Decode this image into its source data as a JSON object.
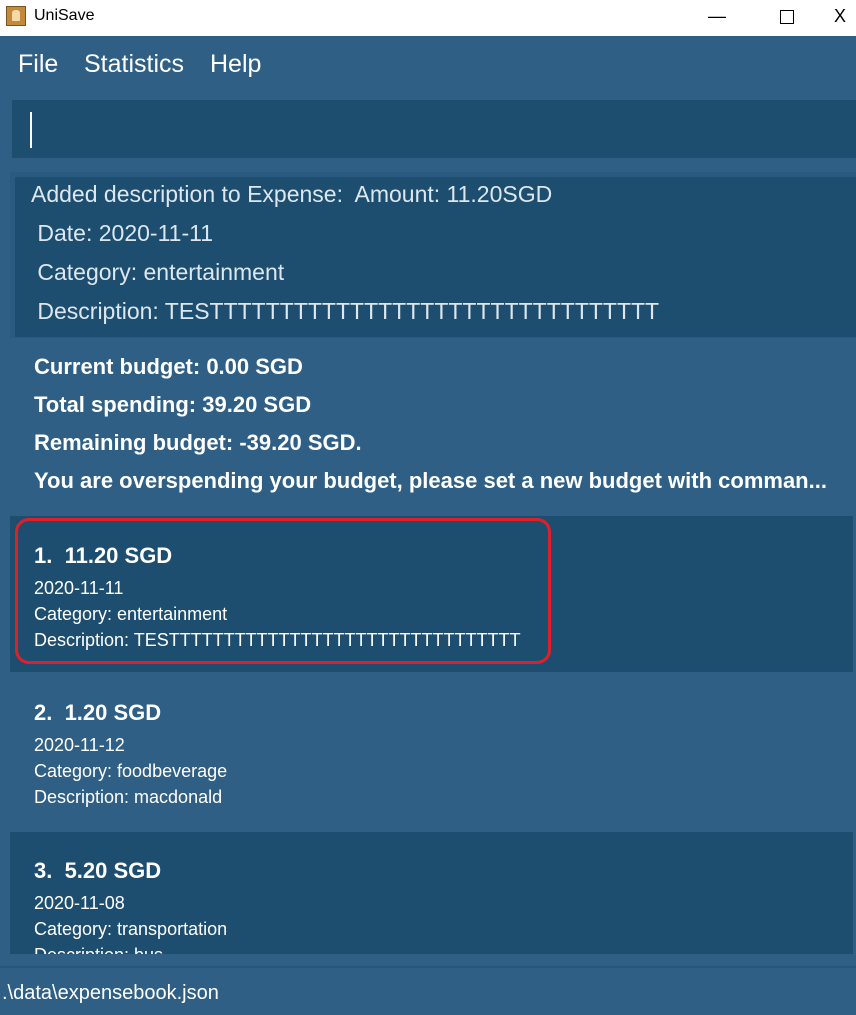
{
  "window": {
    "title": "UniSave",
    "minimize": "—",
    "close": "X"
  },
  "menu": {
    "items": [
      "File",
      "Statistics",
      "Help"
    ]
  },
  "command_box": {
    "value": ""
  },
  "result": {
    "lines": [
      "Added description to Expense:  Amount: 11.20SGD",
      " Date: 2020-11-11",
      " Category: entertainment",
      " Description: TESTTTTTTTTTTTTTTTTTTTTTTTTTTTTTTTT"
    ]
  },
  "budget": {
    "current": "Current budget: 0.00 SGD",
    "spending": "Total spending: 39.20 SGD",
    "remaining": "Remaining budget: -39.20 SGD.",
    "warning": "You are overspending your budget, please set a new budget with comman..."
  },
  "expenses": [
    {
      "title": "1.  11.20 SGD",
      "date": "2020-11-11",
      "category": "Category: entertainment",
      "description": "Description: TESTTTTTTTTTTTTTTTTTTTTTTTTTTTTTTTT"
    },
    {
      "title": "2.  1.20 SGD",
      "date": "2020-11-12",
      "category": "Category: foodbeverage",
      "description": "Description: macdonald"
    },
    {
      "title": "3.  5.20 SGD",
      "date": "2020-11-08",
      "category": "Category: transportation",
      "description": "Description: bus"
    }
  ],
  "status_bar": {
    "path": ".\\data\\expensebook.json"
  },
  "colors": {
    "background": "#2f5f85",
    "panel": "#1d4e70",
    "highlight": "#e02028"
  }
}
